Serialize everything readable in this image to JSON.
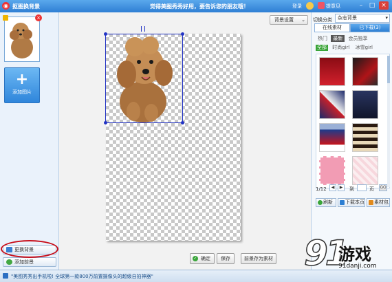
{
  "titlebar": {
    "app_title": "抠图换背景",
    "slogan": "觉得美图秀秀好用，要告诉您的朋友哦！",
    "login": "登录",
    "feedback": "提意见",
    "minimize": "–",
    "maximize": "□",
    "close": "×"
  },
  "left_panel": {
    "add_image_plus": "+",
    "add_image_label": "添加图片",
    "change_bg": "更换背景",
    "add_bg": "添加前景"
  },
  "workspace": {
    "bg_settings": "背景设置",
    "ok": "确定",
    "save": "保存",
    "save_as_material": "前景存为素材"
  },
  "right_panel": {
    "category_label": "切换分类",
    "category_value": "杂志背景",
    "tabs": [
      "在线素材",
      "已下载(3)"
    ],
    "sub_tabs": [
      "热门",
      "最新",
      "会员独享"
    ],
    "filters": [
      "全部",
      "时尚girl",
      "冰雪girl"
    ],
    "pager": {
      "page": "1/12",
      "to": "到",
      "page_unit": "页",
      "go": "GO"
    },
    "buttons": {
      "refresh": "刷新",
      "download_page": "下载本页",
      "material_pack": "素材包"
    }
  },
  "statusbar": {
    "news": "\"美图秀秀出手机啦! 全球第一款800万前置摄像头的超级自拍神器\""
  },
  "watermark": {
    "big": "91",
    "cn": "游戏",
    "url": "91danji.com"
  },
  "colors": {
    "title_blue": "#2f7fd4",
    "selection_blue": "#2233c4",
    "highlight_red": "#c8101c"
  }
}
